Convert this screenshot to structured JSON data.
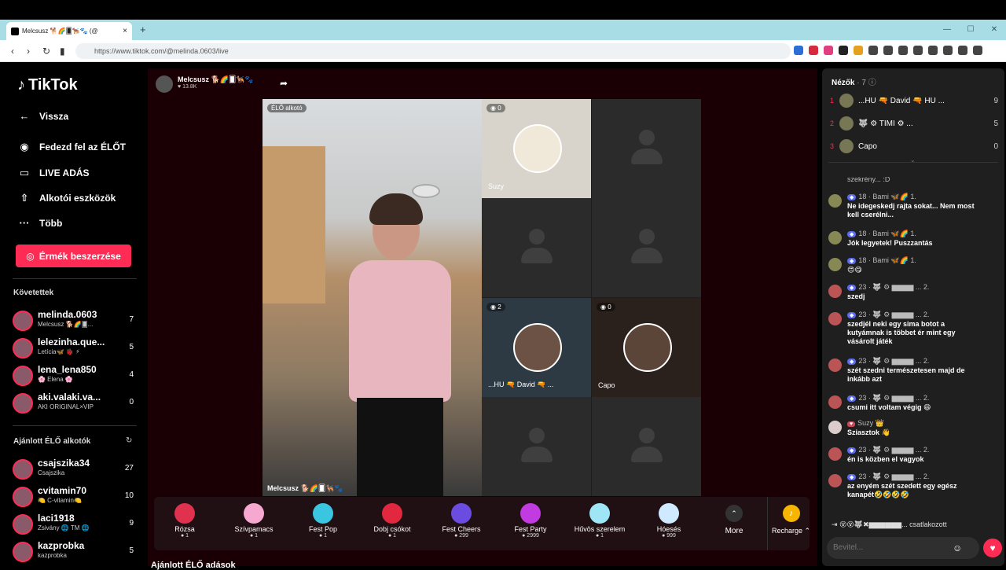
{
  "browser": {
    "tab_title": "Melcsusz 🐕🌈🂠🐕‍🦺🐾 (@",
    "new_tab": "+",
    "url": "https://www.tiktok.com/@melinda.0603/live",
    "win_min": "—",
    "win_max": "☐",
    "win_close": "✕"
  },
  "sidebar": {
    "logo": "TikTok",
    "nav": [
      {
        "label": "Vissza",
        "icon": "←"
      },
      {
        "label": "Fedezd fel az ÉLŐT",
        "icon": "◉"
      },
      {
        "label": "LIVE ADÁS",
        "icon": "▭"
      },
      {
        "label": "Alkotói eszközök",
        "icon": "⇧"
      },
      {
        "label": "Több",
        "icon": "···"
      }
    ],
    "cta": "Érmék beszerzése",
    "following_title": "Követettek",
    "following": [
      {
        "name": "melinda.0603",
        "sub": "Melcsusz 🐕🌈🂠...",
        "count": "7"
      },
      {
        "name": "lelezinha.que...",
        "sub": "Letícia🦋 🐞 ⚡",
        "count": "5"
      },
      {
        "name": "lena_lena850",
        "sub": "🌸 Elena 🌸",
        "count": "4"
      },
      {
        "name": "aki.valaki.va...",
        "sub": "AKI ORIGINAL×VIP",
        "count": "0"
      }
    ],
    "recommended_title": "Ajánlott ÉLŐ alkotók",
    "recommended": [
      {
        "name": "csajszika34",
        "sub": "Csajszika",
        "count": "27"
      },
      {
        "name": "cvitamin70",
        "sub": "🍋 C-vitamin🍋",
        "count": "10"
      },
      {
        "name": "laci1918",
        "sub": "Zsivány 🌐 TM 🌐",
        "count": "9"
      },
      {
        "name": "kazprobka",
        "sub": "kazprobka",
        "count": "5"
      }
    ]
  },
  "stream": {
    "host_name": "Melcsusz 🐕🌈🂠🐕‍🦺🐾",
    "host_likes": "♥ 13.8K",
    "creator_badge": "ÉLŐ alkotó",
    "main_caption": "Melcsusz 🐕🌈🂠🐕‍🦺🐾",
    "tiles": [
      {
        "name": "Suzy",
        "count": "0"
      },
      {
        "name": "...HU 🔫 David 🔫 ...",
        "count": "2"
      },
      {
        "name": "Capo",
        "count": "0"
      }
    ],
    "below_title": "Ajánlott ÉLŐ adások"
  },
  "gifts": [
    {
      "name": "Rózsa",
      "price": "1",
      "color": "#e0314f"
    },
    {
      "name": "Szívpamacs",
      "price": "1",
      "color": "#f7a8d0"
    },
    {
      "name": "Fest Pop",
      "price": "1",
      "color": "#3ac6e0"
    },
    {
      "name": "Dobj csókot",
      "price": "1",
      "color": "#e2283f"
    },
    {
      "name": "Fest Cheers",
      "price": "299",
      "color": "#6a4de0"
    },
    {
      "name": "Fest Party",
      "price": "2999",
      "color": "#c23be0"
    },
    {
      "name": "Hűvös szerelem",
      "price": "1",
      "color": "#9ee6f5"
    },
    {
      "name": "Hóesés",
      "price": "999",
      "color": "#cfe9ff"
    }
  ],
  "gift_more": "More",
  "recharge": "Recharge ⌃",
  "viewers": {
    "title": "Nézők",
    "count": "· 7",
    "list": [
      {
        "rank": "1",
        "name": "...HU 🔫 David 🔫 HU ...",
        "score": "9"
      },
      {
        "rank": "2",
        "name": "🐺 ⚙  TIMI  ⚙ ...",
        "score": "5"
      },
      {
        "rank": "3",
        "name": "Capo",
        "score": "0"
      }
    ]
  },
  "chat": [
    {
      "meta": "",
      "text": "szekrény... :D"
    },
    {
      "meta": "18 · Bami 🦋🌈 1.",
      "text": "Ne idegeskedj rajta sokat... Nem most kell cserélni..."
    },
    {
      "meta": "18 · Bami 🦋🌈 1.",
      "text": "Jók legyetek! Puszzantás"
    },
    {
      "meta": "18 · Bami 🦋🌈 1.",
      "text": "😍😋"
    },
    {
      "meta": "23 · 🐺 ⚙ ▆▆▆▆ ... 2.",
      "text": "szedj"
    },
    {
      "meta": "23 · 🐺 ⚙ ▆▆▆▆ ... 2.",
      "text": "szedjél neki egy sima botot a kutyámnak is többet ér mint egy vásárolt játék"
    },
    {
      "meta": "23 · 🐺 ⚙ ▆▆▆▆ ... 2.",
      "text": "szét szedni természetesen majd de inkább azt"
    },
    {
      "meta": "23 · 🐺 ⚙ ▆▆▆▆ ... 2.",
      "text": "csumi itt voltam végig 😄"
    },
    {
      "meta": "Suzy 👑",
      "text": "Sziasztok 👋"
    },
    {
      "meta": "23 · 🐺 ⚙ ▆▆▆▆ ... 2.",
      "text": "én is közben el vagyok"
    },
    {
      "meta": "23 · 🐺 ⚙ ▆▆▆▆ ... 2.",
      "text": "az enyém szét szedett egy egész kanapét🤣🤣🤣🤣"
    }
  ],
  "joined_text": "😵😵🐺✖▆▆▆▆▆▆...   csatlakozott",
  "input_placeholder": "Bevitel..."
}
